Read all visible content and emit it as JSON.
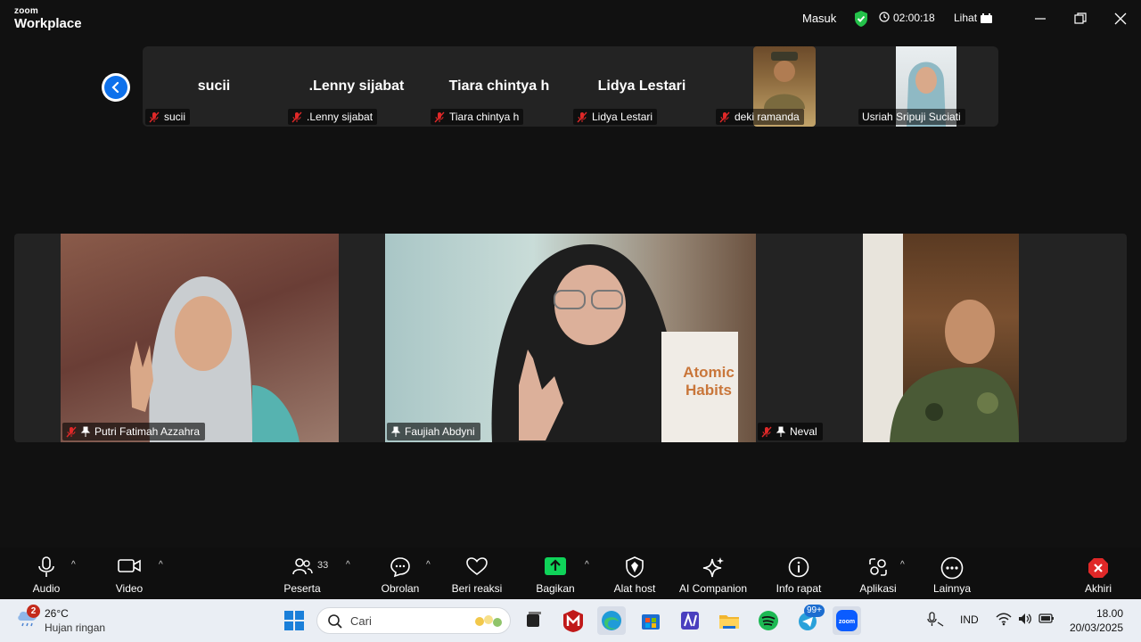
{
  "titlebar": {
    "logo_top": "zoom",
    "logo_bottom": "Workplace",
    "masuk": "Masuk",
    "timer": "02:00:18",
    "lihat": "Lihat"
  },
  "strip": {
    "tiles": [
      {
        "bigname": "sucii",
        "label": "sucii"
      },
      {
        "bigname": ".Lenny sijabat",
        "label": ".Lenny sijabat"
      },
      {
        "bigname": "Tiara chintya h",
        "label": "Tiara chintya h"
      },
      {
        "bigname": "Lidya Lestari",
        "label": "Lidya Lestari"
      },
      {
        "bigname": "",
        "label": "deki ramanda"
      },
      {
        "bigname": "",
        "label": "Usriah Sripuji Suciati"
      }
    ]
  },
  "gallery": {
    "tiles": [
      {
        "name": "Putri Fatimah Azzahra"
      },
      {
        "name": "Faujiah Abdyni",
        "book_line1": "Atomic",
        "book_line2": "Habits"
      },
      {
        "name": "Neval"
      }
    ]
  },
  "controls": {
    "audio": "Audio",
    "video": "Video",
    "participants": "Peserta",
    "participants_count": "33",
    "chat": "Obrolan",
    "react": "Beri reaksi",
    "share": "Bagikan",
    "host_tools": "Alat host",
    "ai": "AI Companion",
    "info": "Info rapat",
    "apps": "Aplikasi",
    "more": "Lainnya",
    "end": "Akhiri"
  },
  "taskbar": {
    "weather_badge": "2",
    "temp": "26°C",
    "condition": "Hujan ringan",
    "search_placeholder": "Cari",
    "telegram_badge": "99+",
    "lang": "IND",
    "time": "18.00",
    "date": "20/03/2025"
  },
  "colors": {
    "accent_blue": "#0e71eb",
    "share_green": "#0fd359",
    "end_red": "#e02828",
    "mute_red": "#e02828"
  }
}
